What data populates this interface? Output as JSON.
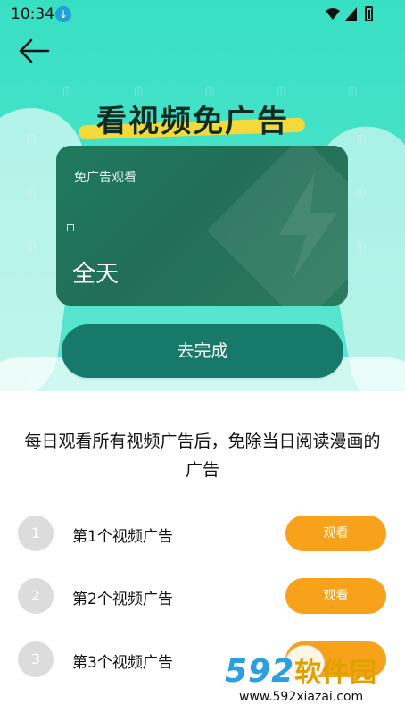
{
  "status_bar": {
    "time": "10:34",
    "download_icon": "download-arrow",
    "wifi_icon": "wifi",
    "signal_icon": "cellular-signal",
    "battery_icon": "battery"
  },
  "header": {
    "back_icon": "arrow-left"
  },
  "banner": {
    "title": "看视频免广告"
  },
  "card": {
    "label": "免广告观看",
    "value": "全天"
  },
  "complete_button": {
    "label": "去完成"
  },
  "description": "每日观看所有视频广告后，免除当日阅读漫画的广告",
  "ads": [
    {
      "number": "1",
      "label": "第1个视频广告",
      "button": "观看"
    },
    {
      "number": "2",
      "label": "第2个视频广告",
      "button": "观看"
    },
    {
      "number": "3",
      "label": "第3个视频广告",
      "button": ""
    }
  ],
  "watermark": {
    "logo_digits": "592",
    "logo_text": "软件园",
    "url": "www.592xiazai.com"
  },
  "colors": {
    "hero_bg": "#46e2c8",
    "card_bg": "#226e57",
    "complete_btn": "#17796a",
    "watch_btn": "#f7a21a",
    "num_badge": "#dcdcdc",
    "banner_highlight": "#f5d83a"
  }
}
